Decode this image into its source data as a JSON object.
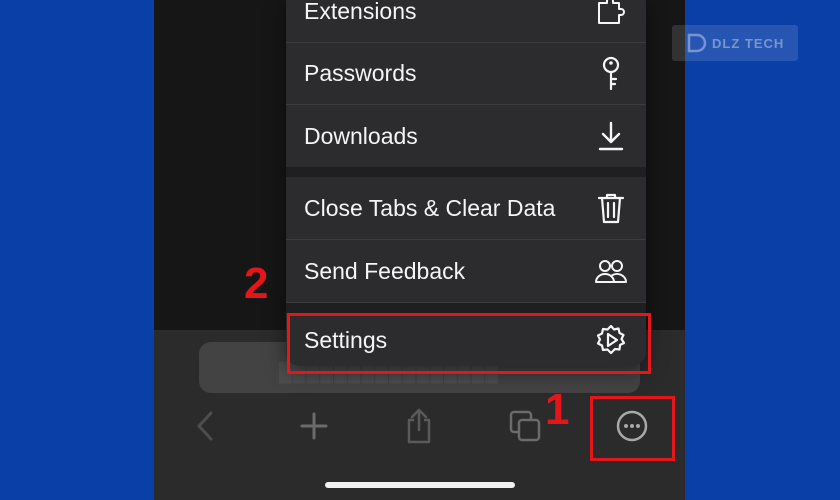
{
  "menu": {
    "items": [
      {
        "label": "Extensions",
        "icon": "puzzle-icon"
      },
      {
        "label": "Passwords",
        "icon": "key-icon"
      },
      {
        "label": "Downloads",
        "icon": "download-icon"
      },
      {
        "label": "Close Tabs & Clear Data",
        "icon": "trash-icon"
      },
      {
        "label": "Send Feedback",
        "icon": "people-icon"
      },
      {
        "label": "Settings",
        "icon": "gear-icon"
      }
    ]
  },
  "annotations": {
    "step1": "1",
    "step2": "2",
    "color": "#e3161b"
  },
  "toolbar": {
    "icons": [
      "back-icon",
      "new-tab-icon",
      "share-icon",
      "tabs-icon",
      "more-icon"
    ]
  },
  "watermark": {
    "text": "DLZ TECH"
  },
  "colors": {
    "background": "#0a3fa8",
    "menu_bg": "#2c2c2e",
    "menu_text": "#f5f5f5"
  }
}
